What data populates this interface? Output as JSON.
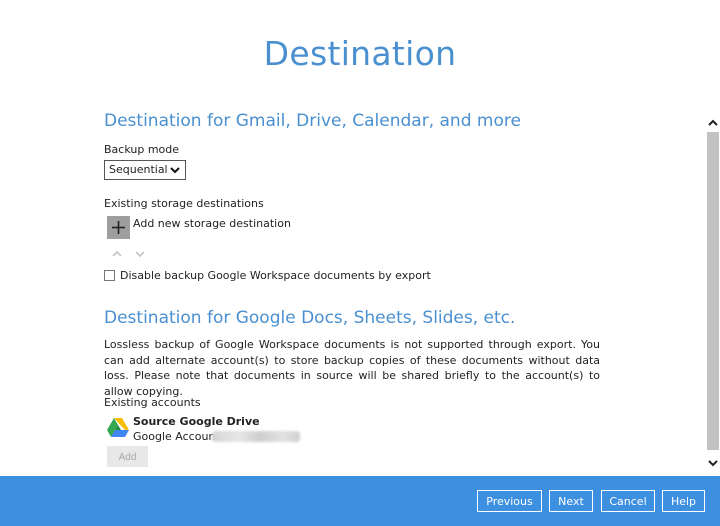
{
  "header": {
    "title": "Destination"
  },
  "section1": {
    "heading": "Destination for Gmail, Drive, Calendar, and more",
    "backup_mode_label": "Backup mode",
    "backup_mode_value": "Sequential",
    "existing_storage_label": "Existing storage destinations",
    "add_storage_label": "Add new storage destination",
    "disable_export_label": "Disable backup Google Workspace documents by export",
    "disable_export_checked": false
  },
  "section2": {
    "heading": "Destination for Google Docs, Sheets, Slides, etc.",
    "description": "Lossless backup of Google Workspace documents is not supported through export. You can add alternate account(s) to store backup copies of these documents without data loss. Please note that documents in source will be shared briefly to the account(s) to allow copying.",
    "existing_accounts_label": "Existing accounts",
    "accounts": [
      {
        "name": "Source Google Drive",
        "email_label": "Google Account:",
        "icon": "google-drive-icon"
      }
    ],
    "add_label": "Add"
  },
  "footer": {
    "previous": "Previous",
    "next": "Next",
    "cancel": "Cancel",
    "help": "Help"
  },
  "colors": {
    "accent": "#4a90d0",
    "footer_bg": "#3d8fe0"
  }
}
